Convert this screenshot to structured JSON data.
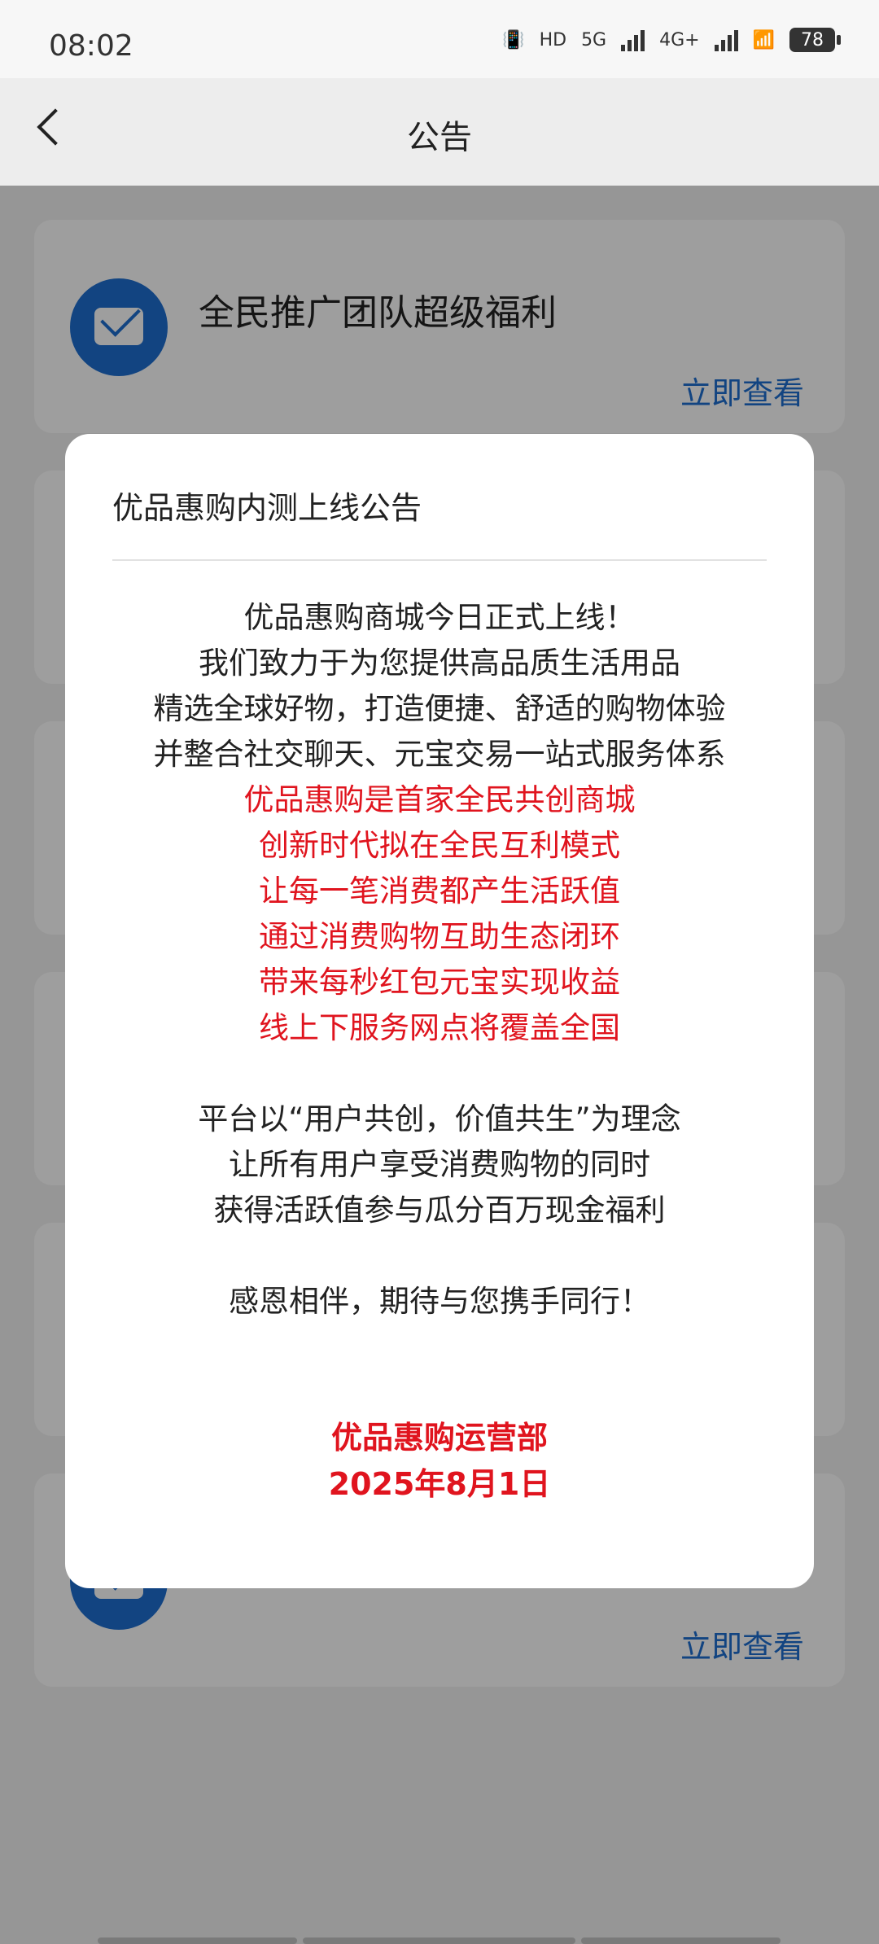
{
  "status_bar": {
    "time": "08:02",
    "network_hd": "HD",
    "network_5g": "5G",
    "network_4g": "4G+",
    "battery": "78"
  },
  "header": {
    "title": "公告"
  },
  "cards": [
    {
      "title": "全民推广团队超级福利",
      "link": "立即查看"
    },
    {
      "title": "",
      "link": "立即查看"
    }
  ],
  "dialog": {
    "title": "优品惠购内测上线公告",
    "paragraph1": [
      "优品惠购商城今日正式上线！",
      "我们致力于为您提供高品质生活用品",
      "精选全球好物，打造便捷、舒适的购物体验",
      "并整合社交聊天、元宝交易一站式服务体系"
    ],
    "highlight": [
      "优品惠购是首家全民共创商城",
      "创新时代拟在全民互利模式",
      "让每一笔消费都产生活跃值",
      "通过消费购物互助生态闭环",
      "带来每秒红包元宝实现收益",
      "线上下服务网点将覆盖全国"
    ],
    "paragraph2": [
      "平台以“用户共创，价值共生”为理念",
      "让所有用户享受消费购物的同时",
      "获得活跃值参与瓜分百万现金福利"
    ],
    "closing": "感恩相伴，期待与您携手同行！",
    "signature": "优品惠购运营部",
    "date": "2025年8月1日"
  },
  "colors": {
    "accent": "#1e6fd0",
    "highlight_red": "#e0141e"
  }
}
